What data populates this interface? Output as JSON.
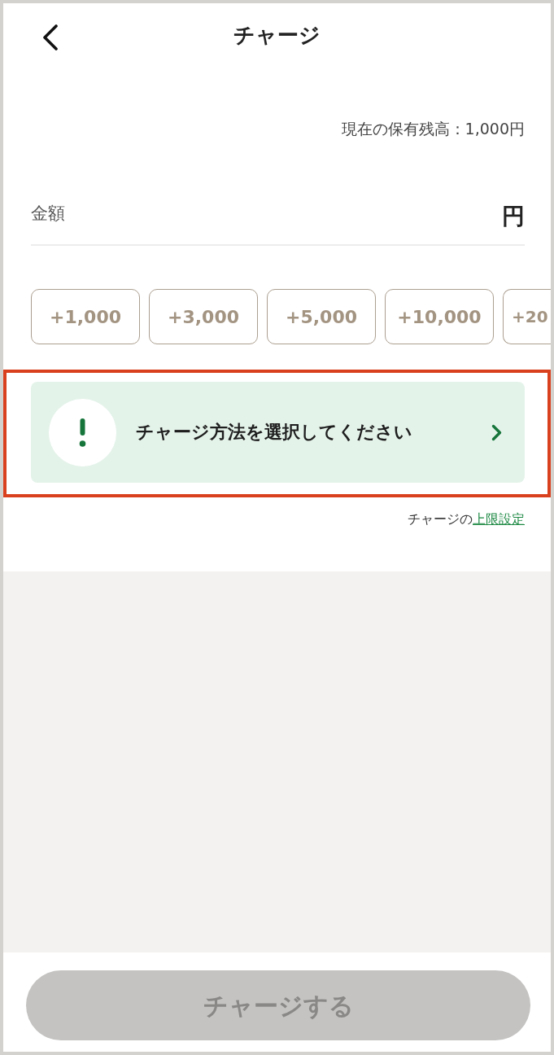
{
  "header": {
    "title": "チャージ"
  },
  "balance": {
    "text": "現在の保有残高：1,000円"
  },
  "amount_field": {
    "label": "金額",
    "unit": "円"
  },
  "quick_amounts": [
    "+1,000",
    "+3,000",
    "+5,000",
    "+10,000",
    "+20"
  ],
  "method_prompt": {
    "text": "チャージ方法を選択してください",
    "highlighted": true
  },
  "limit_note": {
    "text": "チャージの",
    "link": "上限設定"
  },
  "charge_button": {
    "label": "チャージする",
    "disabled": true
  }
}
